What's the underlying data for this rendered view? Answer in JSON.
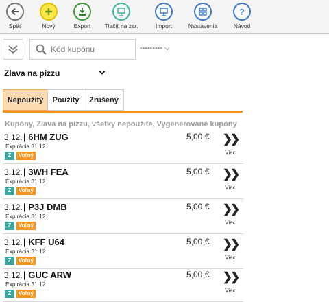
{
  "toolbar": {
    "items": [
      {
        "label": "Späť",
        "icon": "back-arrow-icon"
      },
      {
        "label": "Nový",
        "icon": "plus-icon"
      },
      {
        "label": "Export",
        "icon": "xlsx-export-icon"
      },
      {
        "label": "Tlačiť na zar.",
        "icon": "print-device-icon"
      },
      {
        "label": "Import",
        "icon": "import-icon"
      },
      {
        "label": "Nastavenia",
        "icon": "settings-grid-icon"
      },
      {
        "label": "Návod",
        "icon": "help-icon"
      }
    ]
  },
  "search": {
    "placeholder": "Kód kupónu",
    "value": ""
  },
  "filter_select": {
    "value": "---------"
  },
  "promotion_select": {
    "value": "Zlava na pizzu"
  },
  "tabs": [
    {
      "label": "Nepoužitý",
      "active": true
    },
    {
      "label": "Použitý",
      "active": false
    },
    {
      "label": "Zrušený",
      "active": false
    }
  ],
  "subtitle": "Kupóny, Zlava na pizzu, všetky nepoužité, Vygenerované kupóny",
  "coupons": [
    {
      "date": "3.12.",
      "code": "| 6HM ZUG",
      "price": "5,00 €",
      "expiry": "Expirácia 31.12.",
      "badge_z": "Z",
      "badge_status": "Voľný",
      "more": "Viac"
    },
    {
      "date": "3.12.",
      "code": "| 3WH FEA",
      "price": "5,00 €",
      "expiry": "Expirácia 31.12.",
      "badge_z": "Z",
      "badge_status": "Voľný",
      "more": "Viac"
    },
    {
      "date": "3.12.",
      "code": "| P3J DMB",
      "price": "5,00 €",
      "expiry": "Expirácia 31.12.",
      "badge_z": "Z",
      "badge_status": "Voľný",
      "more": "Viac"
    },
    {
      "date": "3.12.",
      "code": "| KFF U64",
      "price": "5,00 €",
      "expiry": "Expirácia 31.12.",
      "badge_z": "Z",
      "badge_status": "Voľný",
      "more": "Viac"
    },
    {
      "date": "3.12.",
      "code": "| GUC ARW",
      "price": "5,00 €",
      "expiry": "Expirácia 31.12.",
      "badge_z": "Z",
      "badge_status": "Voľný",
      "more": "Viac"
    }
  ],
  "colors": {
    "accent": "#f7941d",
    "tab_active_bg": "#fcd9b0",
    "badge_z": "#3aa6a0",
    "new_icon": "#f4d000",
    "export_icon": "#3b9a3b",
    "print_icon": "#3fb8a0",
    "blue_icons": "#3d79c9"
  }
}
